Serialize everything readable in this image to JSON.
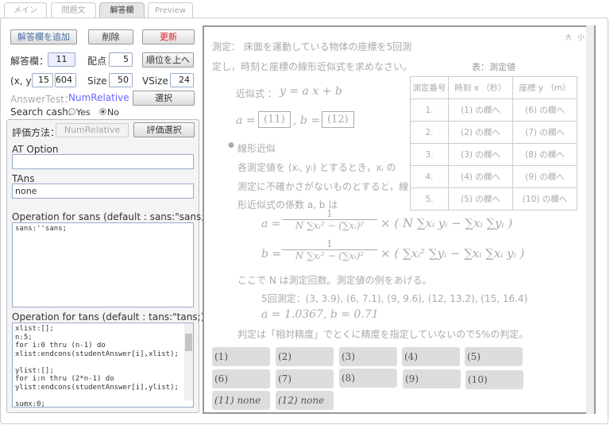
{
  "tabs": [
    "メイン",
    "問題文",
    "解答欄",
    "Preview"
  ],
  "toolbar": {
    "add": "解答欄を追加",
    "delete": "削除",
    "update": "更新",
    "move_up": "順位を上へ",
    "select": "選択"
  },
  "fields": {
    "answer_label": "解答欄：",
    "answer_no": "11",
    "points_label": "配点",
    "points": "5",
    "xy_label": "(x, y)",
    "x": "15",
    "y": "604",
    "size_label": "Size",
    "size": "50",
    "vsize_label": "VSize",
    "vsize": "24",
    "answertest_label": "AnswerTest：",
    "answertest": "NumRelative",
    "search_label": "Search cash:",
    "yes": "Yes",
    "no": "No"
  },
  "panel": {
    "method_label": "評価方法：",
    "method": "NumRelative",
    "method_button": "評価選択",
    "at_option_label": "AT Option",
    "at_option": "",
    "tans_label": "TAns",
    "tans": "none",
    "sans_label": "Operation for sans (default : sans:\"sans;)",
    "sans_code": "sans:''sans;",
    "tans_op_label": "Operation for tans (default : tans:\"tans;)",
    "tans_code": "xlist:[];\nn:5;\nfor i:0 thru (n-1) do\nxlist:endcons(studentAnswer[i],xlist);\n\nylist:[];\nfor i:n thru (2*n-1) do\nylist:endcons(studentAnswer[i],ylist);\n\nsumx:0;"
  },
  "preview": {
    "size_large": "大",
    "size_small": "小",
    "q1": "測定： 床面を運動している物体の座標を5回測",
    "q2": "定し，時刻と座標の線形近似式を求めなさい。",
    "approx_label": "近似式 ：",
    "approx_eq": "y = a x + b",
    "a_eq": "a =",
    "box11": "(11)",
    "b_eq": ", b =",
    "box12": "(12)",
    "bullet": "線形近似",
    "p1": "各測定値を (xᵢ, yᵢ) とするとき，xᵢ の",
    "p2": "測定に不確かさがないものとすると，線",
    "p3": "形近似式の係数 a, b は",
    "fa_lhs": "a =",
    "fb_lhs": "b =",
    "f_num": "1",
    "f_den": "N ∑xᵢ² − (∑xᵢ)²",
    "fa_rhs": "× ( N ∑xᵢ yᵢ − ∑xᵢ ∑yᵢ )",
    "fb_rhs": "× ( ∑xᵢ² ∑yᵢ − ∑xᵢ ∑xᵢ yᵢ )",
    "p4": "ここで N は測定回数。測定値の例をあげる。",
    "example": "5回測定：(3, 3.9), (6, 7.1), (9, 9.6), (12, 13.2), (15, 16.4)",
    "result": "a = 1.0367,    b = 0.71",
    "judge": "判定は「相対精度」でとくに精度を指定していないので5%の判定。",
    "table": {
      "caption": "表：測定値",
      "headers": [
        "測定番号",
        "時刻 x （秒）",
        "座標 y （m）"
      ],
      "rows": [
        [
          "1.",
          "(1) の欄へ",
          "(6) の欄へ"
        ],
        [
          "2.",
          "(2) の欄へ",
          "(7) の欄へ"
        ],
        [
          "3.",
          "(3) の欄へ",
          "(8) の欄へ"
        ],
        [
          "4.",
          "(4) の欄へ",
          "(9) の欄へ"
        ],
        [
          "5.",
          "(5) の欄へ",
          "(10) の欄へ"
        ]
      ]
    },
    "answers": [
      "(1)",
      "(2)",
      "(3)",
      "(4)",
      "(5)",
      "(6)",
      "(7)",
      "(8)",
      "(9)",
      "(10)",
      "(11) none",
      "(12) none"
    ]
  },
  "colors": {
    "update": "#e02020",
    "link": "#6666ff"
  }
}
